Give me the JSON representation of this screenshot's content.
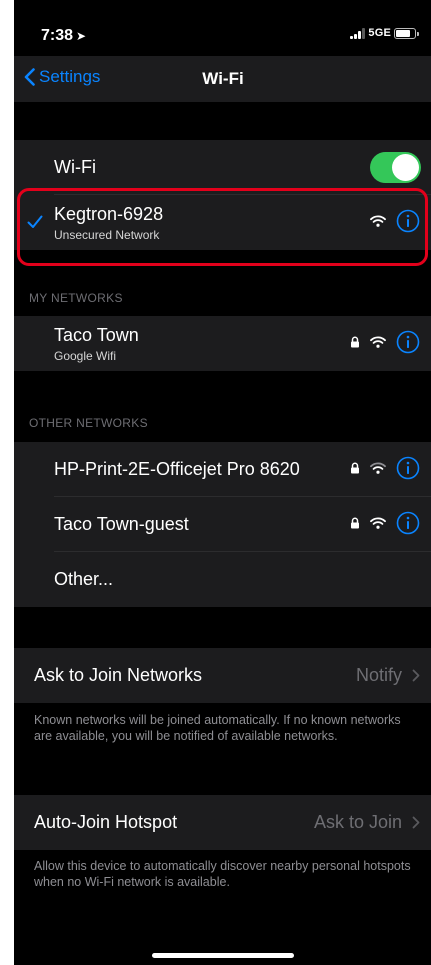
{
  "status_bar": {
    "time": "7:38",
    "location_glyph": "➤",
    "network": "5GE"
  },
  "nav": {
    "back_label": "Settings",
    "title": "Wi-Fi"
  },
  "wifi": {
    "label": "Wi-Fi",
    "enabled": true,
    "toggle_color": "#34c759"
  },
  "connected": {
    "name": "Kegtron-6928",
    "subtitle": "Unsecured Network"
  },
  "my_networks": {
    "header": "MY NETWORKS",
    "items": [
      {
        "name": "Taco Town",
        "subtitle": "Google Wifi",
        "locked": true
      }
    ]
  },
  "other_networks": {
    "header": "OTHER NETWORKS",
    "items": [
      {
        "name": "HP-Print-2E-Officejet Pro 8620",
        "locked": true
      },
      {
        "name": "Taco Town-guest",
        "locked": true
      }
    ],
    "other_label": "Other..."
  },
  "ask_to_join": {
    "label": "Ask to Join Networks",
    "value": "Notify",
    "footer": "Known networks will be joined automatically. If no known networks are available, you will be notified of available networks."
  },
  "auto_join": {
    "label": "Auto-Join Hotspot",
    "value": "Ask to Join",
    "footer": "Allow this device to automatically discover nearby personal hotspots when no Wi-Fi network is available."
  },
  "colors": {
    "accent": "#0a84ff",
    "highlight": "#e3001b",
    "group_bg": "#1c1c1e",
    "background": "#000000"
  }
}
